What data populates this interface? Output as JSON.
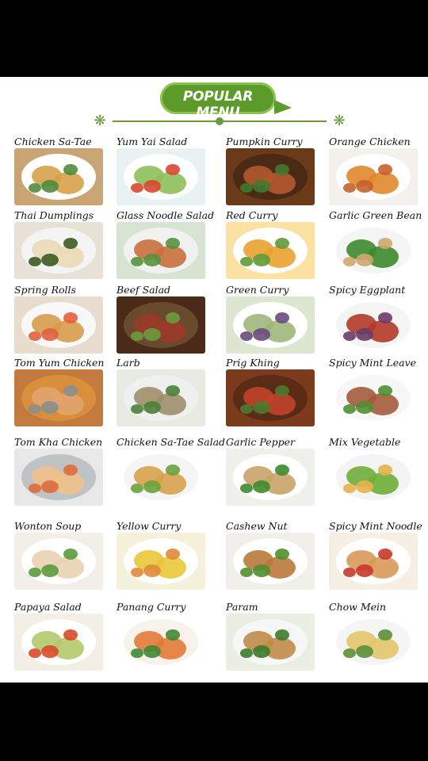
{
  "title": "POPULAR MENU",
  "items": [
    {
      "label": "Chicken Sa-Tae",
      "bg": "#c9a576",
      "plate": "#ffffff",
      "food": "#d7a14b",
      "accent": "#4f8b3a"
    },
    {
      "label": "Yum Yai Salad",
      "bg": "#e9f2f3",
      "plate": "#ffffff",
      "food": "#8ec05a",
      "accent": "#d9472f"
    },
    {
      "label": "Pumpkin Curry",
      "bg": "#6b3a19",
      "plate": "#4a2a14",
      "food": "#b2582c",
      "accent": "#3f7a2e"
    },
    {
      "label": "Orange Chicken",
      "bg": "#f4f1ec",
      "plate": "#ffffff",
      "food": "#e1872d",
      "accent": "#c6622a"
    },
    {
      "label": "Thai Dumplings",
      "bg": "#e8e1d7",
      "plate": "#f4f4f4",
      "food": "#ead9b5",
      "accent": "#3c5b22"
    },
    {
      "label": "Glass Noodle Salad",
      "bg": "#d6e4d1",
      "plate": "#f1f1f1",
      "food": "#c8703c",
      "accent": "#55923e"
    },
    {
      "label": "Red Curry",
      "bg": "#fbe2a2",
      "plate": "#ffffff",
      "food": "#e9a22d",
      "accent": "#5f9b36"
    },
    {
      "label": "Garlic Green Bean",
      "bg": "#ffffff",
      "plate": "#f5f5f5",
      "food": "#3d8a2d",
      "accent": "#cfa96b"
    },
    {
      "label": "Spring Rolls",
      "bg": "#e7dccd",
      "plate": "#f8f8f8",
      "food": "#d79b4a",
      "accent": "#e0603c"
    },
    {
      "label": "Beef Salad",
      "bg": "#4a2b1a",
      "plate": "#6a4a2c",
      "food": "#9b3a2a",
      "accent": "#6c9a3f"
    },
    {
      "label": "Green Curry",
      "bg": "#dde6d1",
      "plate": "#ffffff",
      "food": "#9fb67b",
      "accent": "#6a4b7a"
    },
    {
      "label": "Spicy Eggplant",
      "bg": "#ffffff",
      "plate": "#f5f5f5",
      "food": "#b43a2a",
      "accent": "#6a3c6a"
    },
    {
      "label": "Tom Yum Chicken",
      "bg": "#c37a3f",
      "plate": "#d98e3b",
      "food": "#e0a46f",
      "accent": "#8a8f8d"
    },
    {
      "label": "Larb",
      "bg": "#e8ebe2",
      "plate": "#f0f0f0",
      "food": "#9e8f6a",
      "accent": "#4b7f35"
    },
    {
      "label": "Prig Khing",
      "bg": "#7b3b1c",
      "plate": "#5a2b15",
      "food": "#c0432a",
      "accent": "#4c7a2f"
    },
    {
      "label": "Spicy Mint Leave",
      "bg": "#ffffff",
      "plate": "#f7f7f7",
      "food": "#a35a3b",
      "accent": "#4f8f33"
    },
    {
      "label": "Tom Kha Chicken",
      "bg": "#e8e8e8",
      "plate": "#bfc3c6",
      "food": "#f0c18b",
      "accent": "#e06c3a"
    },
    {
      "label": "Chicken Sa-Tae Salad",
      "bg": "#ffffff",
      "plate": "#f5f5f5",
      "food": "#d8a24b",
      "accent": "#6aa13a"
    },
    {
      "label": "Garlic Pepper",
      "bg": "#eef2ea",
      "plate": "#ffffff",
      "food": "#c9a268",
      "accent": "#3f8a2c"
    },
    {
      "label": "Mix Vegetable",
      "bg": "#ffffff",
      "plate": "#f4f4f4",
      "food": "#6fae3a",
      "accent": "#e6b34a"
    },
    {
      "label": "Wonton Soup",
      "bg": "#f2efe9",
      "plate": "#ffffff",
      "food": "#e9d2b2",
      "accent": "#5c9a3c"
    },
    {
      "label": "Yellow Curry",
      "bg": "#f6f1da",
      "plate": "#ffffff",
      "food": "#e9c63a",
      "accent": "#e08a3a"
    },
    {
      "label": "Cashew Nut",
      "bg": "#f1efe9",
      "plate": "#ffffff",
      "food": "#b9793a",
      "accent": "#4f8f2f"
    },
    {
      "label": "Spicy Mint Noodle",
      "bg": "#f7efe3",
      "plate": "#ffffff",
      "food": "#d89a5a",
      "accent": "#c8372a"
    },
    {
      "label": "Papaya Salad",
      "bg": "#f4efe6",
      "plate": "#ffffff",
      "food": "#b4c96b",
      "accent": "#d84a2a"
    },
    {
      "label": "Panang Curry",
      "bg": "#ffffff",
      "plate": "#f7f2ea",
      "food": "#e27b3a",
      "accent": "#3e8a36"
    },
    {
      "label": "Param",
      "bg": "#e9efe2",
      "plate": "#f7f7f7",
      "food": "#c08a48",
      "accent": "#3d7a2b"
    },
    {
      "label": "Chow Mein",
      "bg": "#ffffff",
      "plate": "#f5f5f5",
      "food": "#e3c56d",
      "accent": "#5b8f39"
    }
  ]
}
